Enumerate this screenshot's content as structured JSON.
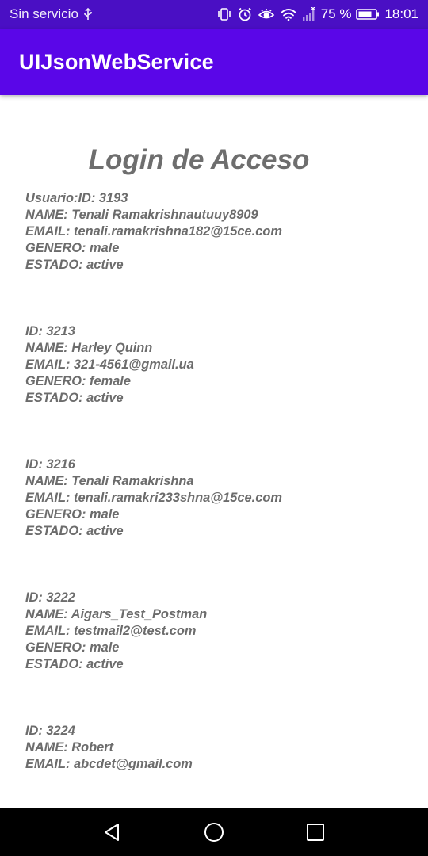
{
  "status_bar": {
    "carrier": "Sin servicio",
    "battery": "75 %",
    "time": "18:01",
    "icons": [
      "usb-icon",
      "vibrate-icon",
      "alarm-icon",
      "eye-comfort-icon",
      "wifi-icon",
      "signal-icon",
      "battery-icon"
    ]
  },
  "app_bar": {
    "title": "UIJsonWebService"
  },
  "page": {
    "heading": "Login de Acceso"
  },
  "users": [
    {
      "id": "Usuario:ID: 3193",
      "name": "NAME: Tenali Ramakrishnautuuy8909",
      "email": "EMAIL: tenali.ramakrishna182@15ce.com",
      "gender": "GENERO: male",
      "status": "ESTADO: active"
    },
    {
      "id": "ID: 3213",
      "name": "NAME: Harley Quinn",
      "email": "EMAIL: 321-4561@gmail.ua",
      "gender": "GENERO: female",
      "status": "ESTADO: active"
    },
    {
      "id": "ID: 3216",
      "name": "NAME: Tenali Ramakrishna",
      "email": "EMAIL: tenali.ramakri233shna@15ce.com",
      "gender": "GENERO: male",
      "status": "ESTADO: active"
    },
    {
      "id": "ID: 3222",
      "name": "NAME: Aigars_Test_Postman",
      "email": "EMAIL: testmail2@test.com",
      "gender": "GENERO: male",
      "status": "ESTADO: active"
    },
    {
      "id": "ID: 3224",
      "name": "NAME: Robert",
      "email": "EMAIL: abcdet@gmail.com"
    }
  ],
  "colors": {
    "status_bar": "#4a0fc4",
    "app_bar": "#5a06e8",
    "text_gray": "#6c6c6c",
    "nav_bar": "#000000"
  },
  "nav_bar": {
    "buttons": [
      "back-icon",
      "home-icon",
      "recents-icon"
    ]
  }
}
